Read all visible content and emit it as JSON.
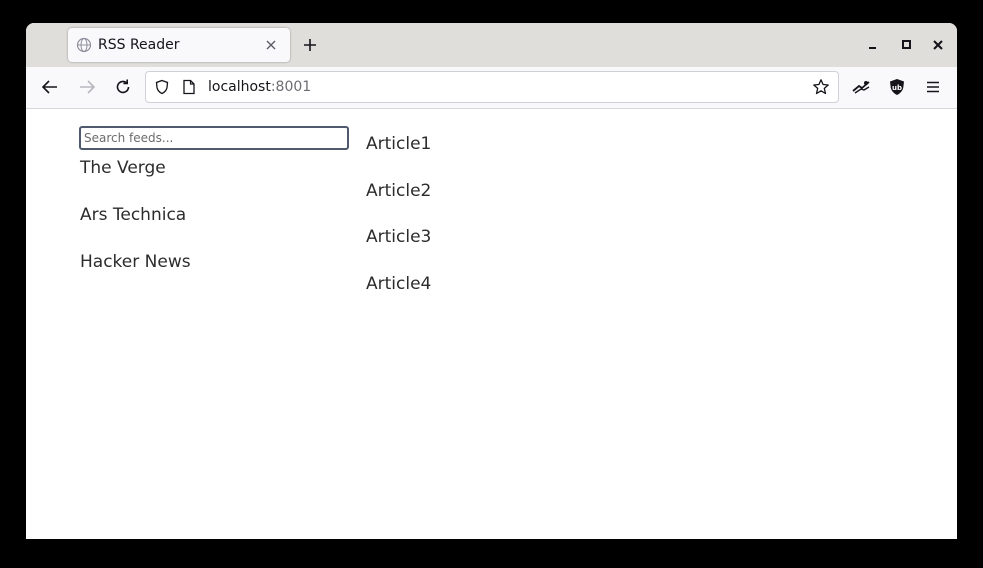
{
  "browser": {
    "tab": {
      "title": "RSS Reader"
    },
    "url": {
      "host": "localhost",
      "port": ":8001"
    }
  },
  "sidebar": {
    "search": {
      "placeholder": "Search feeds...",
      "value": ""
    },
    "feeds": [
      {
        "label": "The Verge"
      },
      {
        "label": "Ars Technica"
      },
      {
        "label": "Hacker News"
      }
    ]
  },
  "main": {
    "articles": [
      {
        "label": "Article1"
      },
      {
        "label": "Article2"
      },
      {
        "label": "Article3"
      },
      {
        "label": "Article4"
      }
    ]
  },
  "colors": {
    "window_background": "#000000",
    "tab_strip": "#e0dedb",
    "toolbar": "#f9f9fb",
    "text": "#2c2c2c",
    "search_border": "#4f5a6e"
  }
}
